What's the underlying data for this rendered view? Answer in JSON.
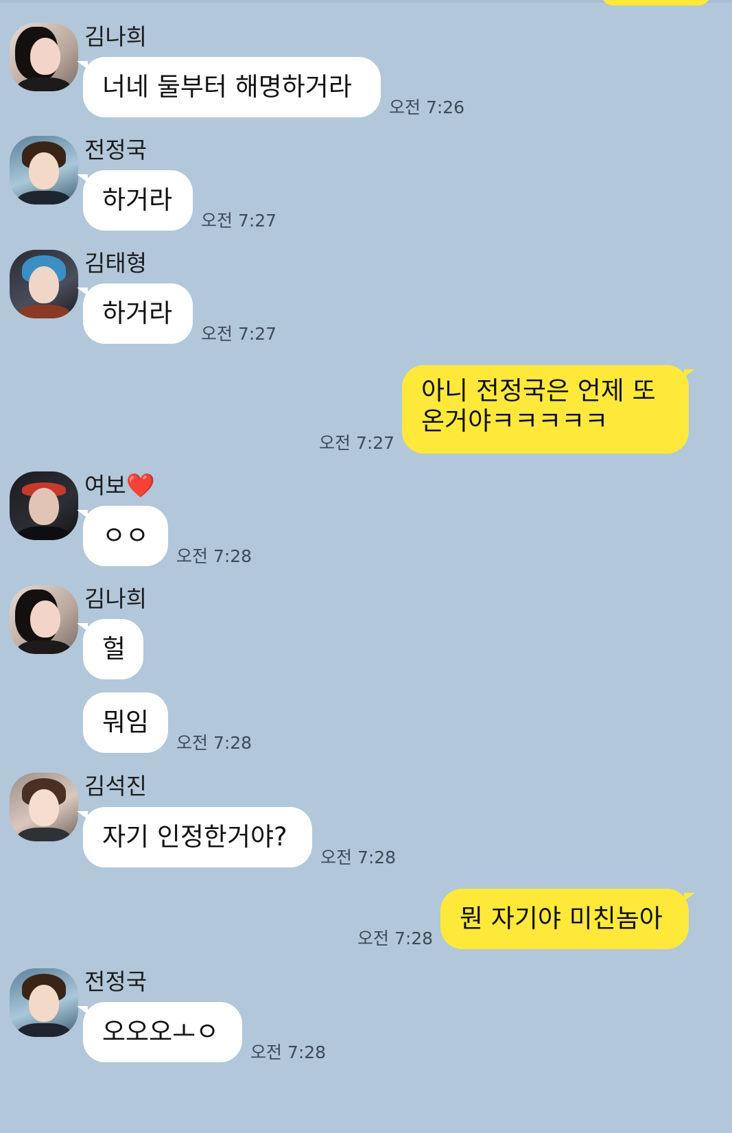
{
  "chat": {
    "messages": [
      {
        "sender": "김나희",
        "text": "너네 둘부터 해명하거라",
        "time": "오전 7:26"
      },
      {
        "sender": "전정국",
        "text": "하거라",
        "time": "오전 7:27"
      },
      {
        "sender": "김태형",
        "text": "하거라",
        "time": "오전 7:27"
      },
      {
        "sender": "me",
        "text": "아니 전정국은 언제 또\n온거야ㅋㅋㅋㅋㅋ",
        "time": "오전 7:27"
      },
      {
        "sender": "여보",
        "sender_suffix": "❤️",
        "text": "ㅇㅇ",
        "time": "오전 7:28"
      },
      {
        "sender": "김나희",
        "text": "헐",
        "time": ""
      },
      {
        "sender": "김나희",
        "text": "뭐임",
        "time": "오전 7:28"
      },
      {
        "sender": "김석진",
        "text": "자기 인정한거야?",
        "time": "오전 7:28"
      },
      {
        "sender": "me",
        "text": "뭔 자기야 미친놈아",
        "time": "오전 7:28"
      },
      {
        "sender": "전정국",
        "text": "오오오ㅗㅇ",
        "time": "오전 7:28"
      }
    ]
  },
  "colors": {
    "background": "#b2c7da",
    "incoming_bubble": "#ffffff",
    "outgoing_bubble": "#fee93b"
  }
}
